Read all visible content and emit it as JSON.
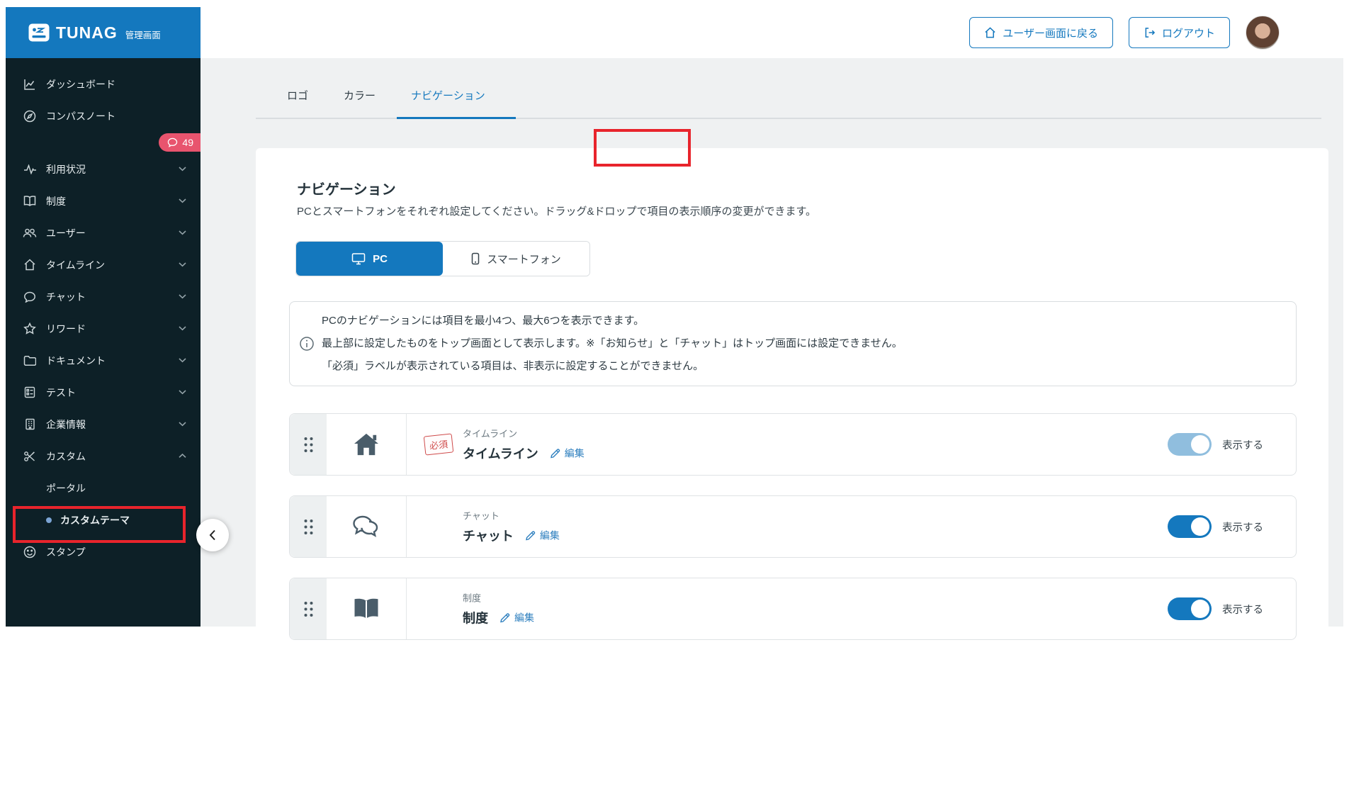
{
  "colors": {
    "accent_blue": "#1478be",
    "sidebar_bg": "#0d2027",
    "badge_pink": "#e8546e",
    "annotation_red": "#e8242c",
    "required_red": "#cf4b4b",
    "toggle_on": "#1478be",
    "toggle_disabled": "#90bede",
    "page_bg": "#eff1f2"
  },
  "sidebar": {
    "logo_text": "TUNAG",
    "logo_suffix": "管理画面",
    "badge_count": "49",
    "items": [
      {
        "label": "ダッシュボード",
        "icon": "chart-line-icon"
      },
      {
        "label": "コンパスノート",
        "icon": "compass-icon"
      },
      {
        "label": "利用状況",
        "icon": "activity-icon",
        "chevron": "down"
      },
      {
        "label": "制度",
        "icon": "book-icon",
        "chevron": "down"
      },
      {
        "label": "ユーザー",
        "icon": "users-icon",
        "chevron": "down"
      },
      {
        "label": "タイムライン",
        "icon": "home-icon",
        "chevron": "down"
      },
      {
        "label": "チャット",
        "icon": "chat-icon",
        "chevron": "down"
      },
      {
        "label": "リワード",
        "icon": "star-icon",
        "chevron": "down"
      },
      {
        "label": "ドキュメント",
        "icon": "folder-icon",
        "chevron": "down"
      },
      {
        "label": "テスト",
        "icon": "checklist-icon",
        "chevron": "down"
      },
      {
        "label": "企業情報",
        "icon": "building-icon",
        "chevron": "down"
      },
      {
        "label": "カスタム",
        "icon": "tools-icon",
        "chevron": "up"
      },
      {
        "label": "ポータル",
        "sub": true
      },
      {
        "label": "カスタムテーマ",
        "sub": true,
        "active": true
      },
      {
        "label": "スタンプ",
        "icon": "smiley-icon"
      }
    ]
  },
  "header": {
    "back_button": "ユーザー画面に戻る",
    "logout_button": "ログアウト"
  },
  "tabs": [
    {
      "label": "ロゴ"
    },
    {
      "label": "カラー"
    },
    {
      "label": "ナビゲーション",
      "active": true
    }
  ],
  "panel": {
    "title": "ナビゲーション",
    "description": "PCとスマートフォンをそれぞれ設定してください。ドラッグ&ドロップで項目の表示順序の変更ができます。",
    "segments": [
      {
        "label": "PC",
        "icon": "monitor-icon",
        "active": true
      },
      {
        "label": "スマートフォン",
        "icon": "smartphone-icon"
      }
    ],
    "info_lines": [
      "PCのナビゲーションには項目を最小4つ、最大6つを表示できます。",
      "最上部に設定したものをトップ画面として表示します。※「お知らせ」と「チャット」はトップ画面には設定できません。",
      "「必須」ラベルが表示されている項目は、非表示に設定することができません。"
    ],
    "rows": [
      {
        "category": "タイムライン",
        "title": "タイムライン",
        "required": "必須",
        "edit": "編集",
        "toggle_label": "表示する",
        "icon": "home-icon",
        "toggle_state": "on-disabled"
      },
      {
        "category": "チャット",
        "title": "チャット",
        "edit": "編集",
        "toggle_label": "表示する",
        "icon": "chat-icon",
        "toggle_state": "on"
      },
      {
        "category": "制度",
        "title": "制度",
        "edit": "編集",
        "toggle_label": "表示する",
        "icon": "book-icon",
        "toggle_state": "on"
      }
    ]
  }
}
